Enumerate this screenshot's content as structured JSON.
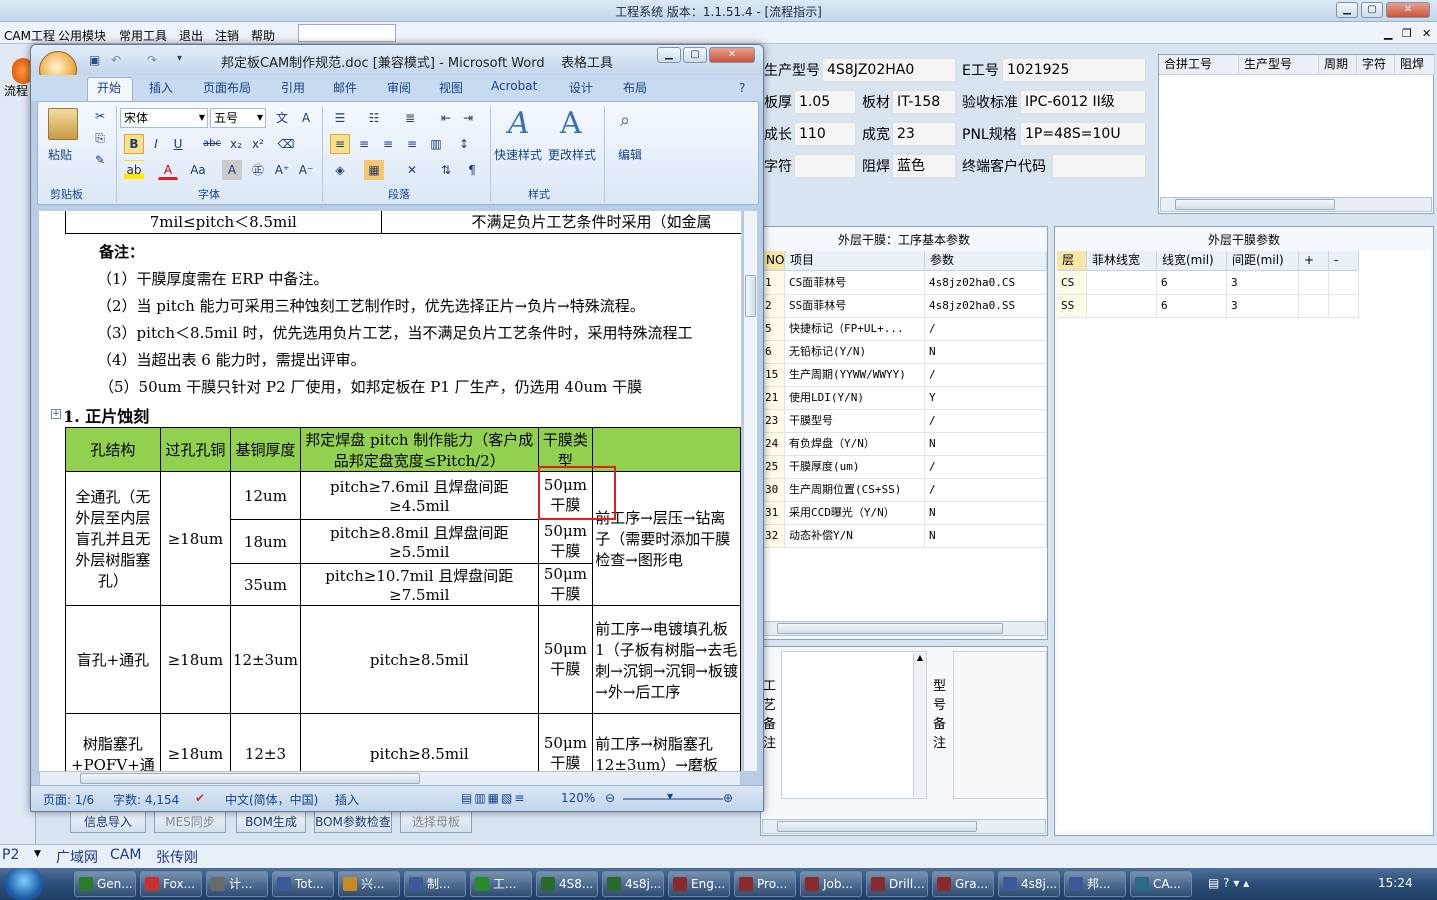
{
  "app": {
    "title": "工程系统   版本：1.1.51.4 - [流程指示]",
    "menu": [
      "CAM工程",
      "公用模块",
      "常用工具",
      "退出",
      "注销",
      "帮助"
    ],
    "left_tab": "流程"
  },
  "info": {
    "model_label": "生产型号",
    "model_value": "4S8JZ02HA0",
    "e_label": "E工号",
    "e_value": "1021925",
    "thick_label": "板厚",
    "thick_value": "1.05",
    "mat_label": "板材",
    "mat_value": "IT-158",
    "accept_label": "验收标准",
    "accept_value": "IPC-6012 II级",
    "len_label": "成长",
    "len_value": "110",
    "width_label": "成宽",
    "width_value": "23",
    "pnl_label": "PNL规格",
    "pnl_value": "1P=48S=10U",
    "char_label": "字符",
    "char_value": "",
    "mask_label": "阻焊",
    "mask_value": "蓝色",
    "cust_label": "终端客户代码",
    "cust_value": ""
  },
  "merge_grid": {
    "columns": [
      "合拼工号",
      "生产型号",
      "周期",
      "字符",
      "阻焊"
    ]
  },
  "film_basic": {
    "title": "外层干膜：工序基本参数",
    "columns": [
      "NO",
      "项目",
      "参数"
    ],
    "rows": [
      [
        "1",
        "CS面菲林号",
        "4s8jz02ha0.CS"
      ],
      [
        "2",
        "SS面菲林号",
        "4s8jz02ha0.SS"
      ],
      [
        "5",
        "快捷标记（FP+UL+...",
        "/"
      ],
      [
        "6",
        "无铅标记(Y/N)",
        "N"
      ],
      [
        "15",
        "生产周期(YYWW/WWYY)",
        "/"
      ],
      [
        "21",
        "使用LDI(Y/N)",
        "Y"
      ],
      [
        "23",
        "干膜型号",
        "/"
      ],
      [
        "24",
        "有负焊盘（Y/N）",
        "N"
      ],
      [
        "25",
        "干膜厚度(um)",
        "/"
      ],
      [
        "30",
        "生产周期位置(CS+SS)",
        "/"
      ],
      [
        "31",
        "采用CCD曝光（Y/N）",
        "N"
      ],
      [
        "32",
        "动态补偿Y/N",
        "N"
      ]
    ]
  },
  "film_params": {
    "title": "外层干膜参数",
    "columns": [
      "层",
      "菲林线宽",
      "线宽(mil)",
      "间距(mil)",
      "+",
      "-"
    ],
    "rows": [
      [
        "CS",
        "",
        "6",
        "3",
        "",
        ""
      ],
      [
        "SS",
        "",
        "6",
        "3",
        "",
        ""
      ]
    ]
  },
  "notes": {
    "process_label": "工艺备注",
    "model_label": "型号备注"
  },
  "bottom_buttons": [
    "信息导入",
    "MES同步",
    "BOM生成",
    "BOM参数检查",
    "选择母板"
  ],
  "status_bar": {
    "combo": "P2",
    "items": [
      "广域网",
      "CAM",
      "张传刚"
    ]
  },
  "word": {
    "title": "邦定板CAM制作规范.doc [兼容模式] - Microsoft Word",
    "context_tab": "表格工具",
    "tabs": [
      "开始",
      "插入",
      "页面布局",
      "引用",
      "邮件",
      "审阅",
      "视图",
      "Acrobat",
      "设计",
      "布局"
    ],
    "font_name": "宋体",
    "font_size": "五号",
    "groups": [
      "剪贴板",
      "字体",
      "段落",
      "样式",
      "编辑"
    ],
    "paste_label": "粘贴",
    "quick_style": "快速样式",
    "change_style": "更改样式",
    "edit_label": "编辑",
    "status": {
      "page": "页面: 1/6",
      "words": "字数: 4,154",
      "lang": "中文(简体，中国)",
      "mode": "插入",
      "zoom": "120%"
    },
    "doc": {
      "top_row_left": "7mil≤pitch＜8.5mil",
      "top_row_right": "不满足负片工艺条件时采用（如金属",
      "remark_title": "备注：",
      "remarks": [
        "（1）干膜厚度需在 ERP 中备注。",
        "（2）当 pitch 能力可采用三种蚀刻工艺制作时，优先选择正片→负片→特殊流程。",
        "（3）pitch＜8.5mil 时，优先选用负片工艺，当不满足负片工艺条件时，采用特殊流程工",
        "（4）当超出表 6 能力时，需提出评审。",
        "（5）50um 干膜只针对 P2 厂使用，如邦定板在 P1 厂生产，仍选用 40um 干膜"
      ],
      "section": "1. 正片蚀刻",
      "table_header": [
        "孔结构",
        "过孔孔铜",
        "基铜厚度",
        "邦定焊盘 pitch 制作能力（客户成品邦定盘宽度≤Pitch/2）",
        "干膜类型",
        ""
      ],
      "r1_struct": "全通孔（无外层至内层盲孔并且无外层树脂塞孔）",
      "r1_via": "≥18um",
      "r1_rows": [
        [
          "12um",
          "pitch≥7.6mil 且焊盘间距≥4.5mil",
          "50μm干膜"
        ],
        [
          "18um",
          "pitch≥8.8mil 且焊盘间距≥5.5mil",
          "50μm干膜"
        ],
        [
          "35um",
          "pitch≥10.7mil 且焊盘间距≥7.5mil",
          "50μm干膜"
        ]
      ],
      "r1_flow": "前工序→层压→钻离子（需要时添加干膜检查→图形电",
      "r2": [
        "盲孔+通孔",
        "≥18um",
        "12±3um",
        "pitch≥8.5mil",
        "50μm干膜",
        "前工序→电镀填孔板 1（子板有树脂→去毛刺→沉铜→沉铜→板镀→外→后工序"
      ],
      "r3": [
        "树脂塞孔+POFV+通",
        "≥18um",
        "12±3",
        "pitch≥8.5mil",
        "50μm干膜",
        "前工序→树脂塞孔12±3um）→磨板"
      ]
    }
  },
  "taskbar": {
    "items": [
      "Gen...",
      "Fox...",
      "计...",
      "Tot...",
      "兴...",
      "制...",
      "工...",
      "4S8...",
      "4s8j...",
      "Eng...",
      "Pro...",
      "Job...",
      "Drill...",
      "Gra...",
      "4s8j...",
      "邦...",
      "CA..."
    ],
    "clock": "15:24"
  }
}
